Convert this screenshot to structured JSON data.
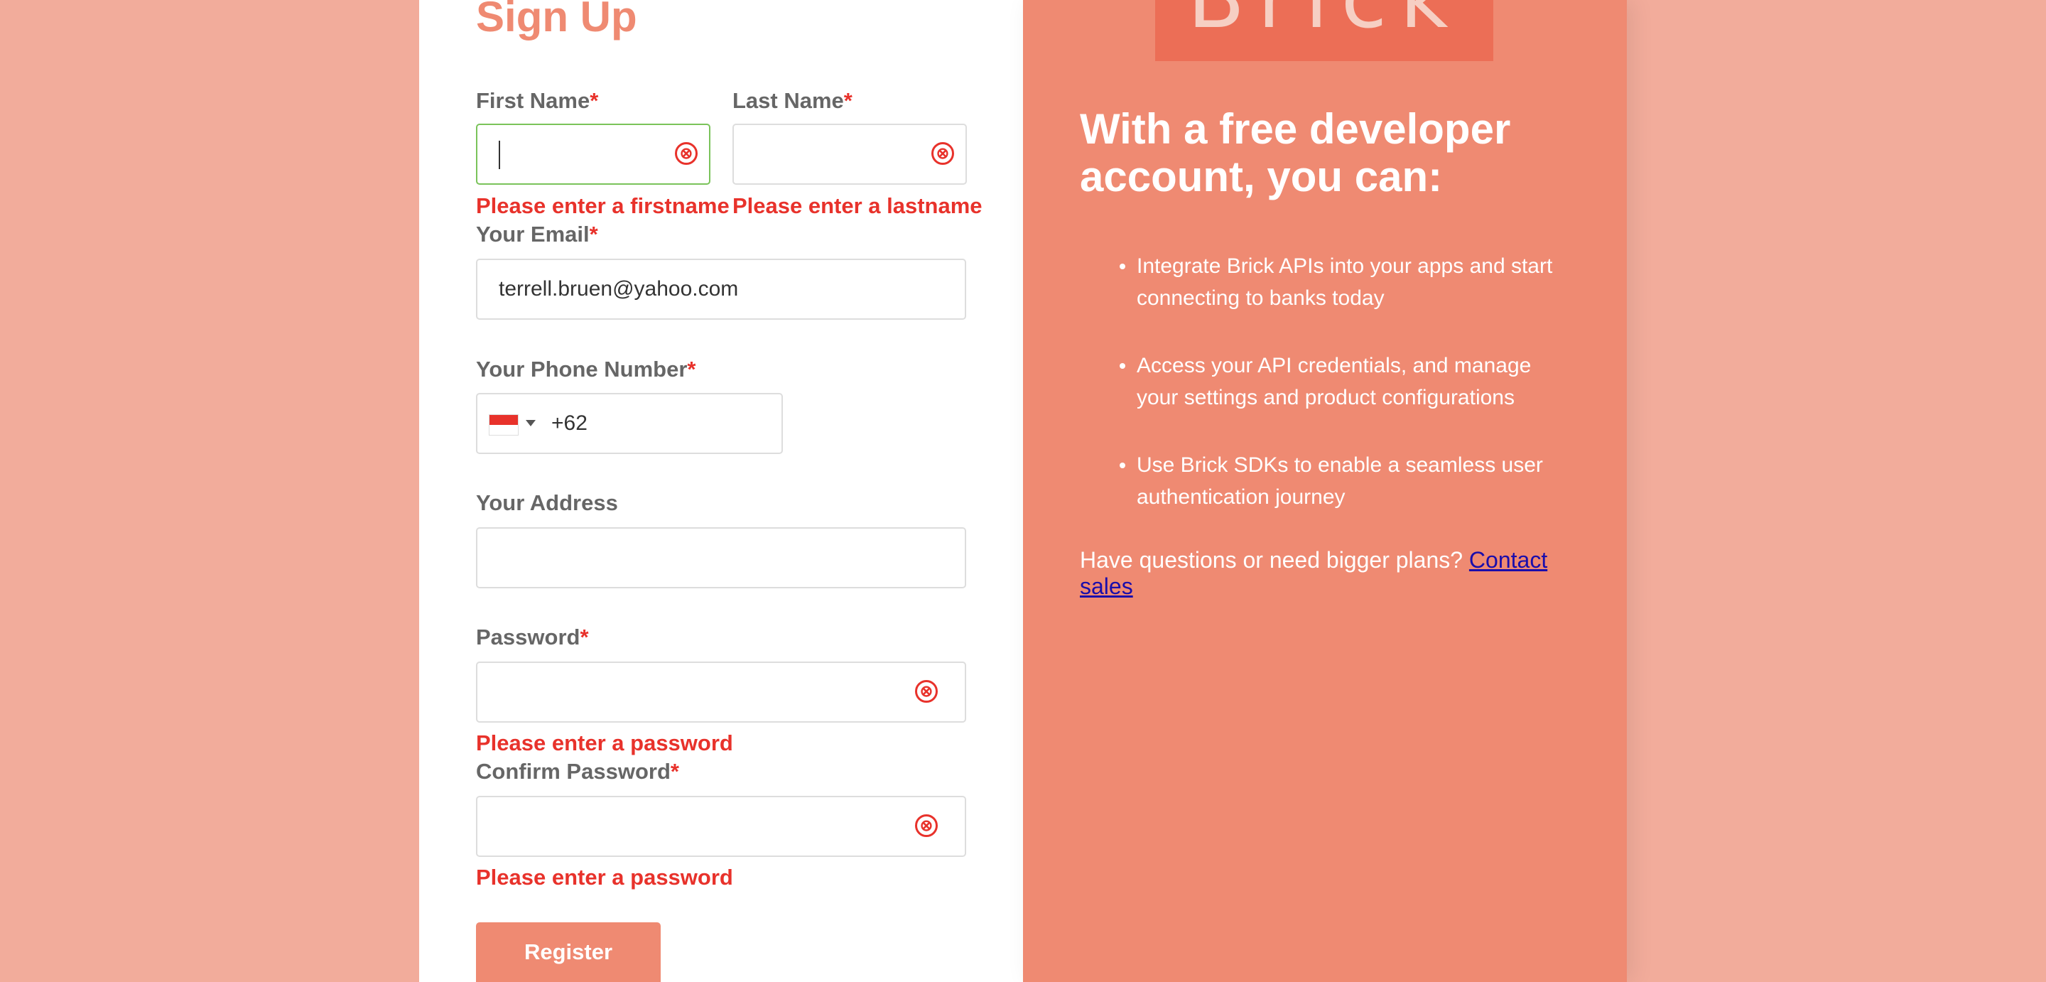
{
  "form": {
    "title": "Sign Up",
    "required_mark": "*",
    "first_name": {
      "label": "First Name",
      "value": "",
      "error": "Please enter a firstname"
    },
    "last_name": {
      "label": "Last Name",
      "value": "",
      "error": "Please enter a lastname"
    },
    "email": {
      "label": "Your Email",
      "value": "terrell.bruen@yahoo.com"
    },
    "phone": {
      "label": "Your Phone Number",
      "dial_code": "+62",
      "country_flag": "indonesia-flag-icon"
    },
    "address": {
      "label": "Your Address",
      "value": ""
    },
    "password": {
      "label": "Password",
      "value": "",
      "error": "Please enter a password"
    },
    "confirm_password": {
      "label": "Confirm Password",
      "value": "",
      "error": "Please enter a password"
    },
    "register_label": "Register",
    "clear_icon": "⊗"
  },
  "promo": {
    "logo_text": "Brick",
    "headline": "With a free developer account, you can:",
    "bullets": [
      "Integrate Brick APIs into your apps and start connecting to banks today",
      "Access your API credentials, and manage your settings and product configurations",
      "Use Brick SDKs to enable a seamless user authentication journey"
    ],
    "contact_text": "Have questions or need bigger plans?",
    "contact_link": "Contact sales"
  },
  "colors": {
    "page_bg": "#f2ac9b",
    "accent": "#ef8a72",
    "error": "#e8322b",
    "focus_border": "#7ac35a"
  }
}
